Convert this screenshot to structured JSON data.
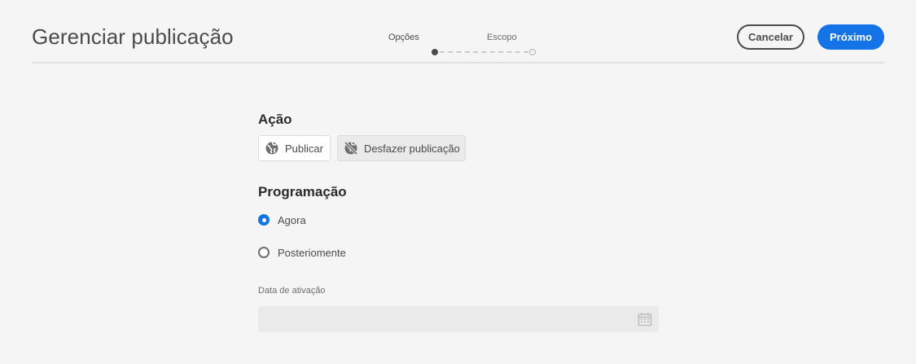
{
  "header": {
    "title": "Gerenciar publicação",
    "steps": [
      {
        "label": "Opções",
        "active": true
      },
      {
        "label": "Escopo",
        "active": false
      }
    ],
    "cancel_label": "Cancelar",
    "next_label": "Próximo"
  },
  "action": {
    "title": "Ação",
    "publish_label": "Publicar",
    "publish_icon": "globe-icon",
    "unpublish_label": "Desfazer publicação",
    "unpublish_icon": "globe-strike-icon"
  },
  "schedule": {
    "title": "Programação",
    "options": [
      {
        "label": "Agora",
        "selected": true
      },
      {
        "label": "Posteriomente",
        "selected": false
      }
    ],
    "activation_date_label": "Data de ativação",
    "activation_date_value": "",
    "calendar_icon": "calendar-icon"
  },
  "colors": {
    "accent": "#1473e6",
    "background": "#f5f5f5"
  }
}
